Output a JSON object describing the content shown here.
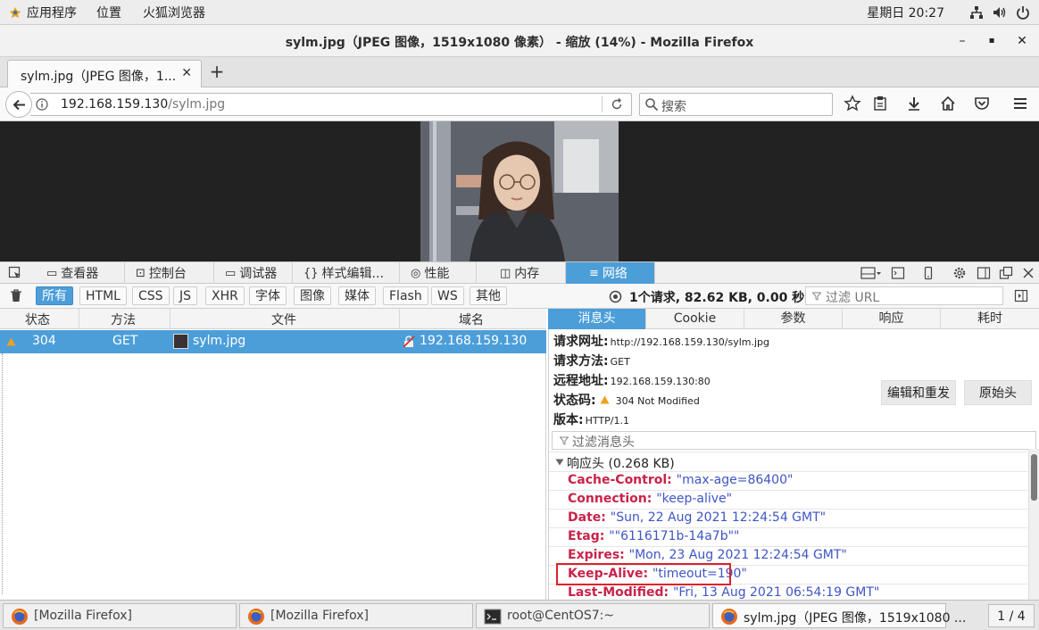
{
  "topbar": {
    "apps": "应用程序",
    "places": "位置",
    "firefox": "火狐浏览器",
    "clock": "星期日 20:27"
  },
  "window": {
    "title": "sylm.jpg（JPEG 图像，1519x1080 像素）  - 缩放 (14%) - Mozilla Firefox",
    "minimize": "–",
    "maximize": "▪",
    "close": "✕"
  },
  "tab": {
    "label": "sylm.jpg（JPEG 图像，1...",
    "close": "✕",
    "new_tab": "+"
  },
  "navbar": {
    "url_host": "192.168.159.130",
    "url_path": "/sylm.jpg",
    "search_placeholder": "搜索"
  },
  "devtools": {
    "tabs": [
      {
        "label": "查看器",
        "icon": "inspector-icon"
      },
      {
        "label": "控制台",
        "icon": "console-icon"
      },
      {
        "label": "调试器",
        "icon": "debugger-icon"
      },
      {
        "label": "样式编辑...",
        "icon": "style-editor-icon"
      },
      {
        "label": "性能",
        "icon": "performance-icon"
      },
      {
        "label": "内存",
        "icon": "memory-icon"
      },
      {
        "label": "网络",
        "icon": "network-icon"
      }
    ],
    "filters": [
      "所有",
      "HTML",
      "CSS",
      "JS",
      "XHR",
      "字体",
      "图像",
      "媒体",
      "Flash",
      "WS",
      "其他"
    ],
    "summary": "1个请求, 82.62 KB, 0.00 秒",
    "url_filter_placeholder": "过滤 URL",
    "columns": [
      "状态",
      "方法",
      "文件",
      "域名"
    ],
    "request": {
      "status": "304",
      "method": "GET",
      "file": "sylm.jpg",
      "domain": "192.168.159.130"
    },
    "detail_tabs": [
      "消息头",
      "Cookie",
      "参数",
      "响应",
      "耗时"
    ],
    "summary_rows": [
      {
        "key": "请求网址:",
        "value": "http://192.168.159.130/sylm.jpg"
      },
      {
        "key": "请求方法:",
        "value": "GET"
      },
      {
        "key": "远程地址:",
        "value": "192.168.159.130:80"
      },
      {
        "key": "状态码:",
        "value": "304  Not  Modified"
      },
      {
        "key": "版本:",
        "value": "HTTP/1.1"
      }
    ],
    "edit_resend": "编辑和重发",
    "raw_headers": "原始头",
    "header_filter_placeholder": "过滤消息头",
    "response_group": "响应头 (0.268 KB)",
    "response_headers": [
      {
        "key": "Cache-Control",
        "value": "\"max-age=86400\""
      },
      {
        "key": "Connection",
        "value": "\"keep-alive\""
      },
      {
        "key": "Date",
        "value": "\"Sun, 22 Aug 2021 12:24:54 GMT\""
      },
      {
        "key": "Etag",
        "value": "\"\"6116171b-14a7b\"\""
      },
      {
        "key": "Expires",
        "value": "\"Mon, 23 Aug 2021 12:24:54 GMT\""
      },
      {
        "key": "Keep-Alive",
        "value": "\"timeout=190\""
      },
      {
        "key": "Last-Modified",
        "value": "\"Fri, 13 Aug 2021 06:54:19 GMT\""
      }
    ]
  },
  "taskbar": {
    "items": [
      {
        "label": "[Mozilla Firefox]",
        "icon": "firefox-icon"
      },
      {
        "label": "[Mozilla Firefox]",
        "icon": "firefox-icon"
      },
      {
        "label": "root@CentOS7:~",
        "icon": "terminal-icon"
      },
      {
        "label": "sylm.jpg（JPEG 图像，1519x1080 ...",
        "icon": "firefox-icon"
      }
    ],
    "pager": "1 / 4"
  },
  "colors": {
    "accent": "#4c9ed9",
    "header_key": "#c9234a",
    "header_value": "#3e55c5",
    "highlight_box": "#e0202a"
  }
}
